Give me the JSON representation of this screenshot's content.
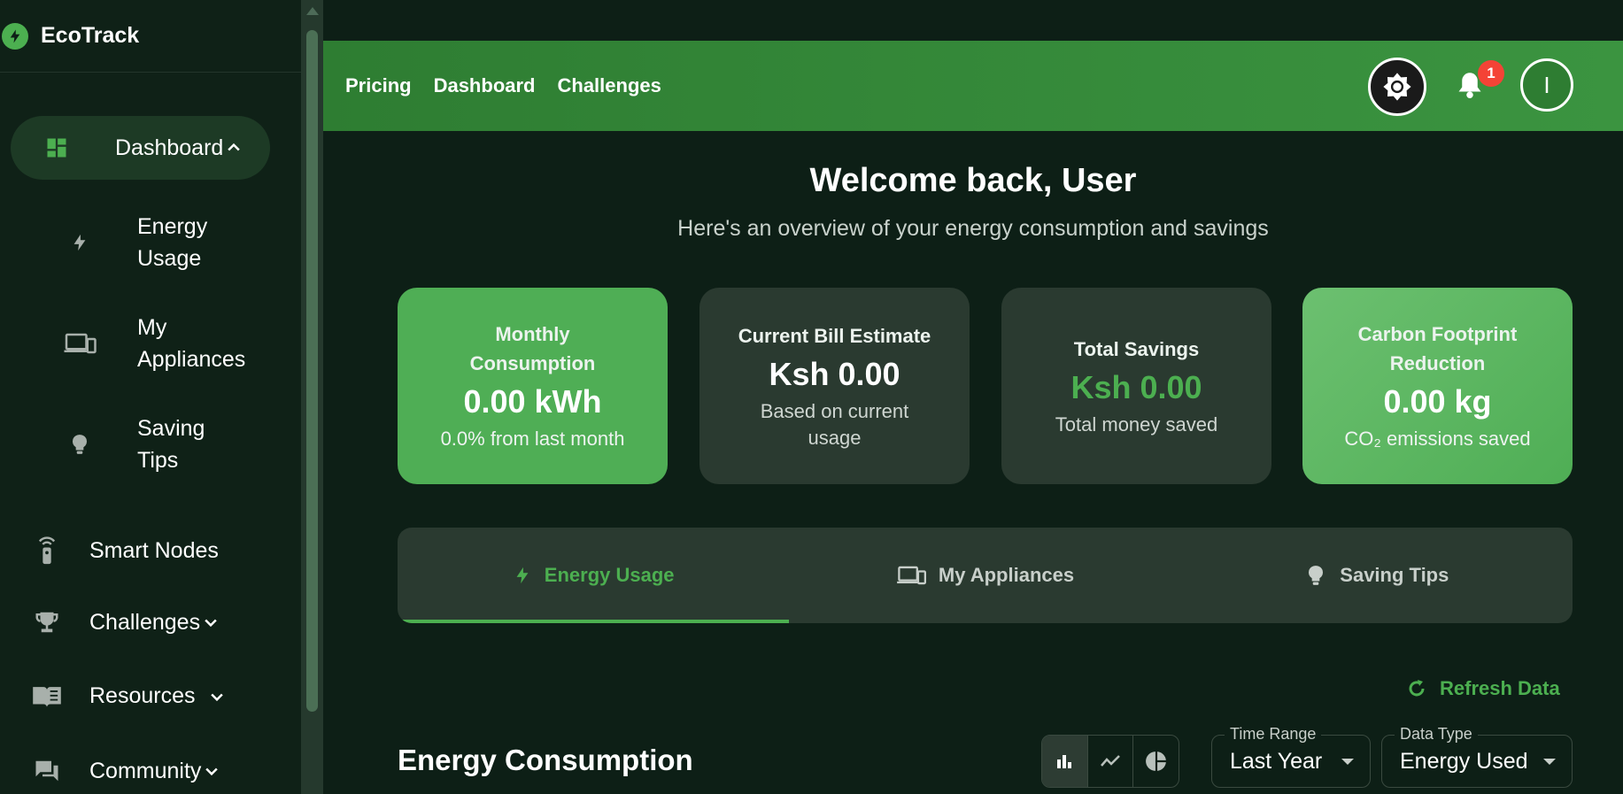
{
  "brand": {
    "name": "EcoTrack"
  },
  "sidebar": {
    "dashboard": "Dashboard",
    "sub_items": [
      {
        "line1": "Energy",
        "line2": "Usage"
      },
      {
        "line1": "My",
        "line2": "Appliances"
      },
      {
        "line1": "Saving",
        "line2": "Tips"
      }
    ],
    "items": [
      "Smart Nodes",
      "Challenges",
      "Resources",
      "Community"
    ]
  },
  "topbar": {
    "links": [
      "Pricing",
      "Dashboard",
      "Challenges"
    ],
    "notification_count": "1",
    "avatar_initial": "I"
  },
  "welcome": {
    "title": "Welcome back, User",
    "subtitle": "Here's an overview of your energy consumption and savings"
  },
  "cards": [
    {
      "title": "Monthly Consumption",
      "value": "0.00 kWh",
      "note": "0.0% from last month"
    },
    {
      "title": "Current Bill Estimate",
      "value": "Ksh 0.00",
      "note": "Based on current usage"
    },
    {
      "title": "Total Savings",
      "value": "Ksh 0.00",
      "note": "Total money saved"
    },
    {
      "title": "Carbon Footprint Reduction",
      "value": "0.00 kg",
      "note": "CO₂ emissions saved"
    }
  ],
  "tabs": [
    "Energy Usage",
    "My Appliances",
    "Saving Tips"
  ],
  "refresh_label": "Refresh Data",
  "section_title": "Energy Consumption",
  "filters": {
    "time_range": {
      "label": "Time Range",
      "value": "Last Year"
    },
    "data_type": {
      "label": "Data Type",
      "value": "Energy Used"
    }
  },
  "colors": {
    "accent": "#4caf50",
    "topbar": "#2e7d32",
    "badge": "#f44336"
  }
}
